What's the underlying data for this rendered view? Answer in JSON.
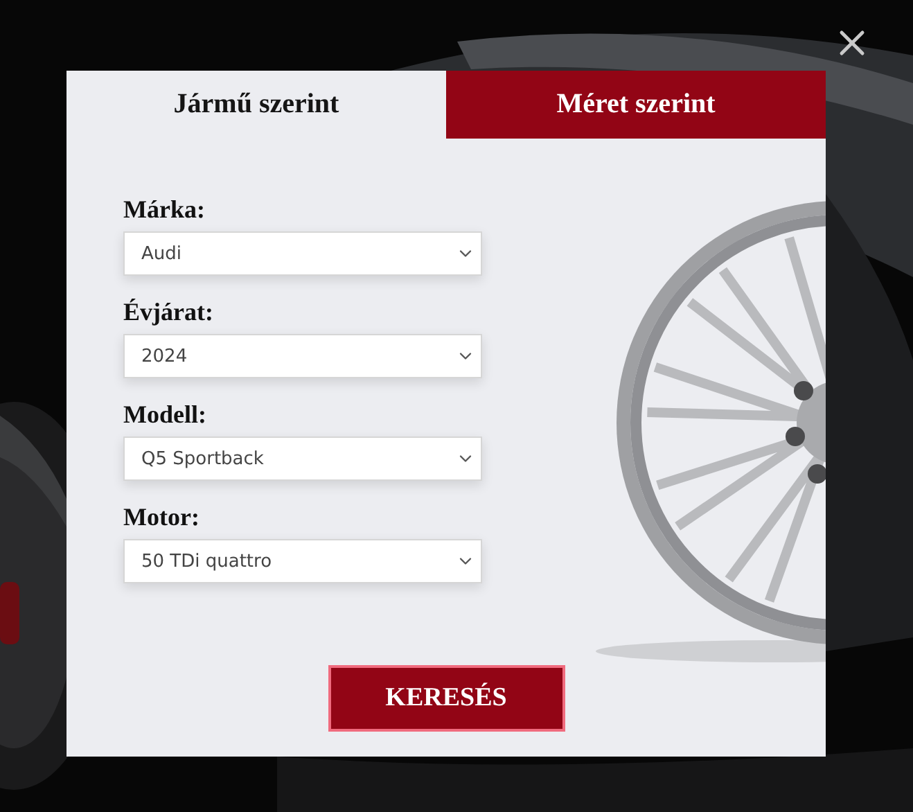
{
  "tabs": [
    {
      "label": "Jármű szerint",
      "selected": true
    },
    {
      "label": "Méret szerint",
      "selected": false
    }
  ],
  "fields": [
    {
      "label": "Márka:",
      "value": "Audi"
    },
    {
      "label": "Évjárat:",
      "value": "2024"
    },
    {
      "label": "Modell:",
      "value": "Q5 Sportback"
    },
    {
      "label": "Motor:",
      "value": "50 TDi quattro"
    }
  ],
  "search_button": "KERESÉS"
}
